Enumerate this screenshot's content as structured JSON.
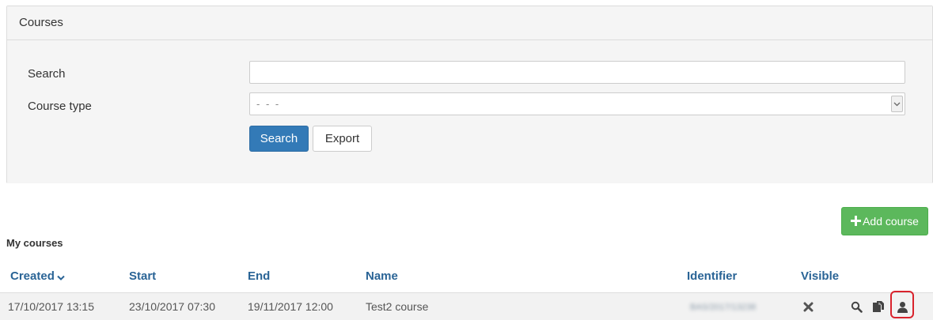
{
  "panel": {
    "title": "Courses",
    "search_label": "Search",
    "search_value": "",
    "course_type_label": "Course type",
    "course_type_value": "- - -",
    "search_button": "Search",
    "export_button": "Export"
  },
  "add_course_button": "Add course",
  "section_title": "My courses",
  "table": {
    "headers": {
      "created": "Created",
      "start": "Start",
      "end": "End",
      "name": "Name",
      "identifier": "Identifier",
      "visible": "Visible"
    },
    "sort": {
      "column": "created",
      "direction": "desc"
    },
    "rows": [
      {
        "created": "17/10/2017 13:15",
        "start": "23/10/2017 07:30",
        "end": "19/11/2017 12:00",
        "name": "Test2 course",
        "identifier": "BAS/2017/13238",
        "visible_icon": "x-icon",
        "actions": [
          "view-icon",
          "copy-icon",
          "user-icon"
        ]
      }
    ]
  },
  "colors": {
    "primary": "#337ab7",
    "success": "#5cb85c",
    "link": "#2a6496",
    "highlight": "#d9232d"
  }
}
